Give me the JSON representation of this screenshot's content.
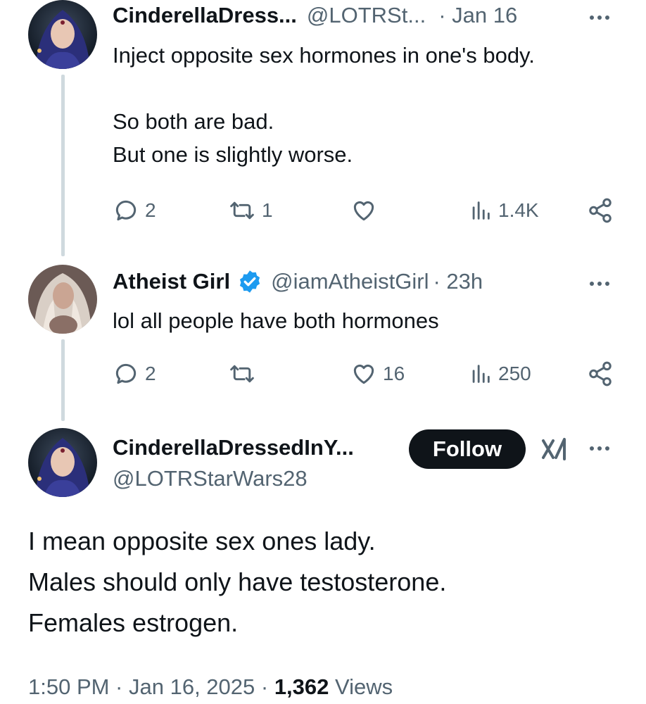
{
  "tweet1": {
    "display_name": "CinderellaDress...",
    "handle": "@LOTRSt...",
    "time": "· Jan 16",
    "lines": [
      "Inject opposite sex hormones in one's body.",
      "",
      "So both are bad.",
      "But one is slightly worse."
    ],
    "replies": "2",
    "reposts": "1",
    "likes": "",
    "views": "1.4K"
  },
  "tweet2": {
    "display_name": "Atheist Girl",
    "verified": true,
    "handle": "@iamAtheistGirl",
    "time": "· 23h",
    "lines": [
      "lol all people have both hormones"
    ],
    "replies": "2",
    "reposts": "",
    "likes": "16",
    "views": "250"
  },
  "main": {
    "display_name": "CinderellaDressedInY...",
    "handle": "@LOTRStarWars28",
    "follow_label": "Follow",
    "lines": [
      "I mean opposite sex ones lady.",
      "Males should only have testosterone.",
      "Females estrogen."
    ],
    "timestamp": "1:50 PM · Jan 16, 2025 · ",
    "views_count": "1,362",
    "views_label": " Views"
  },
  "colors": {
    "text": "#0f1419",
    "secondary": "#536471",
    "verified": "#1d9bf0",
    "line": "#cfd9de"
  },
  "icons": [
    "reply-icon",
    "repost-icon",
    "like-icon",
    "views-icon",
    "share-icon",
    "more-icon",
    "verified-icon",
    "grok-icon"
  ]
}
